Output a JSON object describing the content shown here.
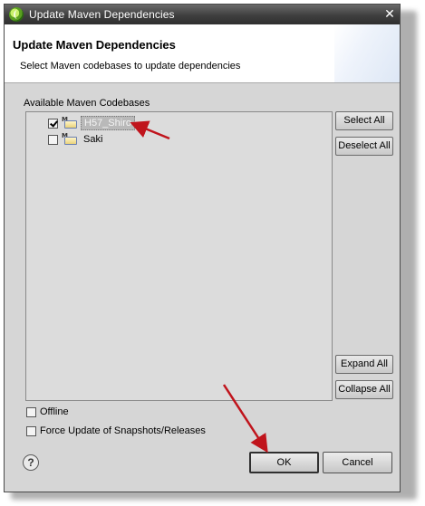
{
  "window": {
    "title": "Update Maven Dependencies",
    "close_glyph": "✕"
  },
  "header": {
    "title": "Update Maven Dependencies",
    "description": "Select Maven codebases to update dependencies"
  },
  "codebases": {
    "label": "Available Maven Codebases",
    "items": [
      {
        "label": "H57_Shiro",
        "checked": true,
        "selected": true,
        "icon": "maven-project-folder-icon"
      },
      {
        "label": "Saki",
        "checked": false,
        "selected": false,
        "icon": "maven-project-folder-icon"
      }
    ]
  },
  "side_buttons": {
    "select_all": "Select All",
    "deselect_all": "Deselect All",
    "expand_all": "Expand All",
    "collapse_all": "Collapse All"
  },
  "options": {
    "offline": {
      "label": "Offline",
      "checked": false
    },
    "force_update": {
      "label": "Force Update of Snapshots/Releases",
      "checked": false
    }
  },
  "footer": {
    "help_glyph": "?",
    "ok": "OK",
    "cancel": "Cancel"
  },
  "colors": {
    "annotation_arrow": "#c0141c",
    "dialog_bg": "#d6d6d6",
    "titlebar": "#3f3f3f"
  },
  "maven_badge": "M"
}
